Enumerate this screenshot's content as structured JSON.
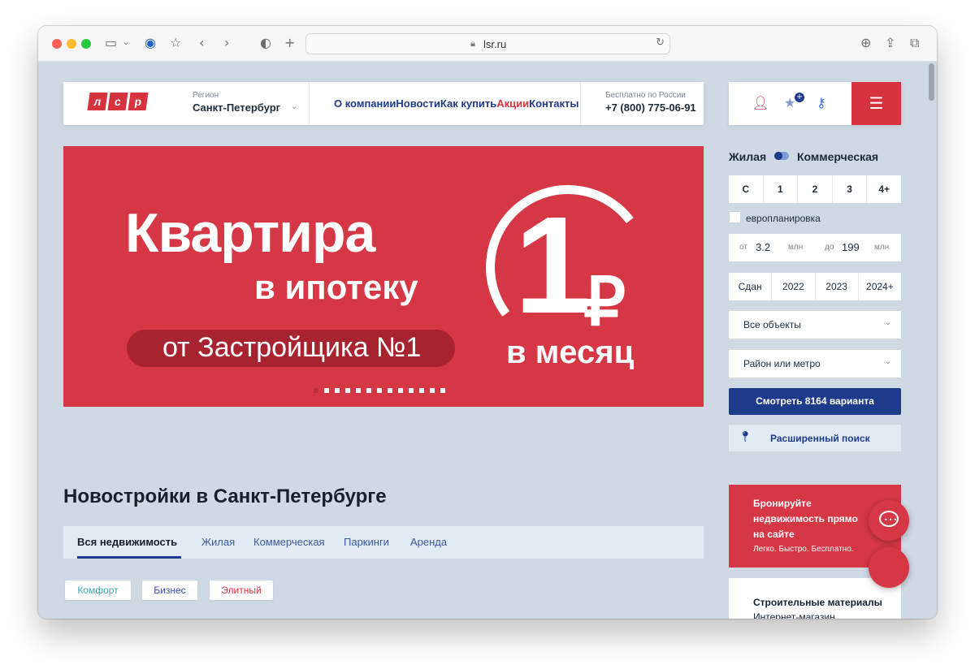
{
  "browser": {
    "url": "lsr.ru",
    "icons": [
      "sidebar-icon",
      "chevron-down-icon",
      "vpn-icon",
      "bookmark-star-icon",
      "back-icon",
      "forward-icon",
      "shield-icon",
      "new-tab-icon",
      "lock-icon",
      "reload-icon",
      "download-icon",
      "share-icon",
      "tabs-icon"
    ]
  },
  "header": {
    "logo_letters": [
      "л",
      "с",
      "р"
    ],
    "region_label": "Регион",
    "region_value": "Санкт-Петербург",
    "nav": [
      {
        "label": "О компании",
        "accent": false
      },
      {
        "label": "Новости",
        "accent": false
      },
      {
        "label": "Как купить",
        "accent": false
      },
      {
        "label": "Акции",
        "accent": true
      },
      {
        "label": "Контакты",
        "accent": false
      }
    ],
    "phone_label": "Бесплатно по России",
    "phone_value": "+7 (800) 775-06-91",
    "favorites_badge": "+"
  },
  "banner": {
    "line1": "Квартира",
    "line2": "в ипотеку",
    "pill": "от Застройщика №1",
    "number": "1",
    "currency": "₽",
    "period": "в месяц",
    "slides_count": 13,
    "active_slide": 1
  },
  "filter": {
    "type_left": "Жилая",
    "type_right": "Коммерческая",
    "rooms": [
      "С",
      "1",
      "2",
      "3",
      "4+"
    ],
    "euro_label": "европланировка",
    "price_from_label": "от",
    "price_from": "3.2",
    "price_from_unit": "млн",
    "price_to_label": "до",
    "price_to": "199",
    "price_to_unit": "млн",
    "years": [
      "Сдан",
      "2022",
      "2023",
      "2024+"
    ],
    "objects_select": "Все объекты",
    "district_select": "Район или метро",
    "cta": "Смотреть 8164 варианта",
    "advanced": "Расширенный поиск"
  },
  "section": {
    "title": "Новостройки в Санкт-Петербурге",
    "tabs": [
      "Вся недвижимость",
      "Жилая",
      "Коммерческая",
      "Паркинги",
      "Аренда"
    ],
    "chips": [
      "Комфорт",
      "Бизнес",
      "Элитный"
    ]
  },
  "promo": {
    "title": "Бронируйте недвижимость прямо на сайте",
    "subtitle": "Легко. Быстро. Бесплатно."
  },
  "materials": {
    "title": "Строительные материалы",
    "subtitle": "Интернет-магазин"
  },
  "colors": {
    "brand_red": "#d63745",
    "brand_blue": "#1e3a8a",
    "page_bg": "#cfd9e3"
  }
}
